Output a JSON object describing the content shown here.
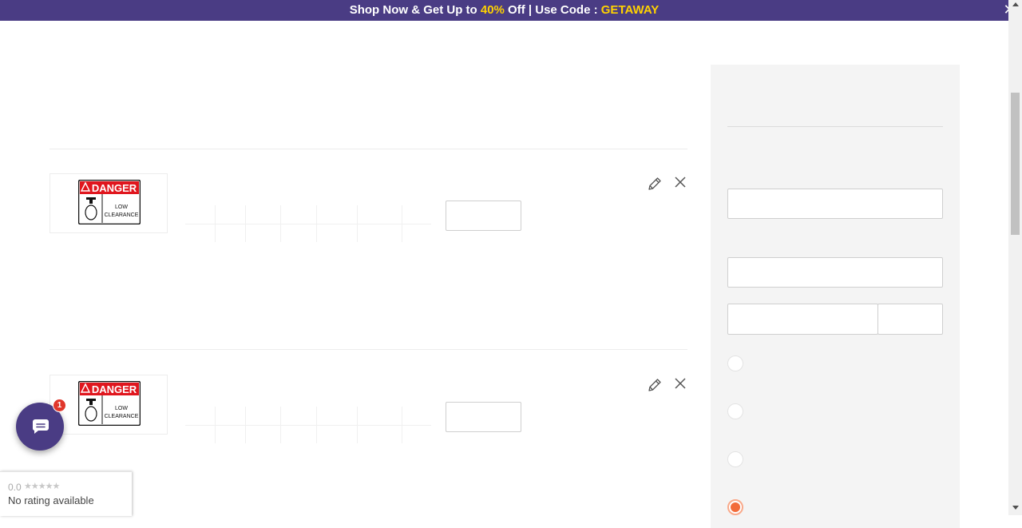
{
  "promo": {
    "text_1": "Shop Now & Get Up to ",
    "discount": "40%",
    "text_2": " Off | Use Code : ",
    "code": "GETAWAY",
    "close_glyph": "✕",
    "icon": "close-icon"
  },
  "cart": {
    "items": [
      {
        "sign": {
          "header": "DANGER",
          "line1": "LOW",
          "line2": "CLEARANCE"
        },
        "quantity": "",
        "edit_icon": "pencil-icon",
        "remove_icon": "close-icon"
      },
      {
        "sign": {
          "header": "DANGER",
          "line1": "LOW",
          "line2": "CLEARANCE"
        },
        "quantity": "",
        "edit_icon": "pencil-icon",
        "remove_icon": "close-icon"
      }
    ]
  },
  "summary": {
    "fields": [
      "",
      "",
      "",
      ""
    ],
    "shipping_options_count": 4,
    "selected_option_index": 3
  },
  "chat": {
    "badge": "1",
    "icon": "chat-icon"
  },
  "rating": {
    "score": "0.0",
    "stars": "★★★★★",
    "label": "No rating available"
  },
  "colors": {
    "brand": "#4a3c84",
    "highlight": "#ffd200",
    "accent": "#f26b3a",
    "danger": "#e0362b"
  }
}
